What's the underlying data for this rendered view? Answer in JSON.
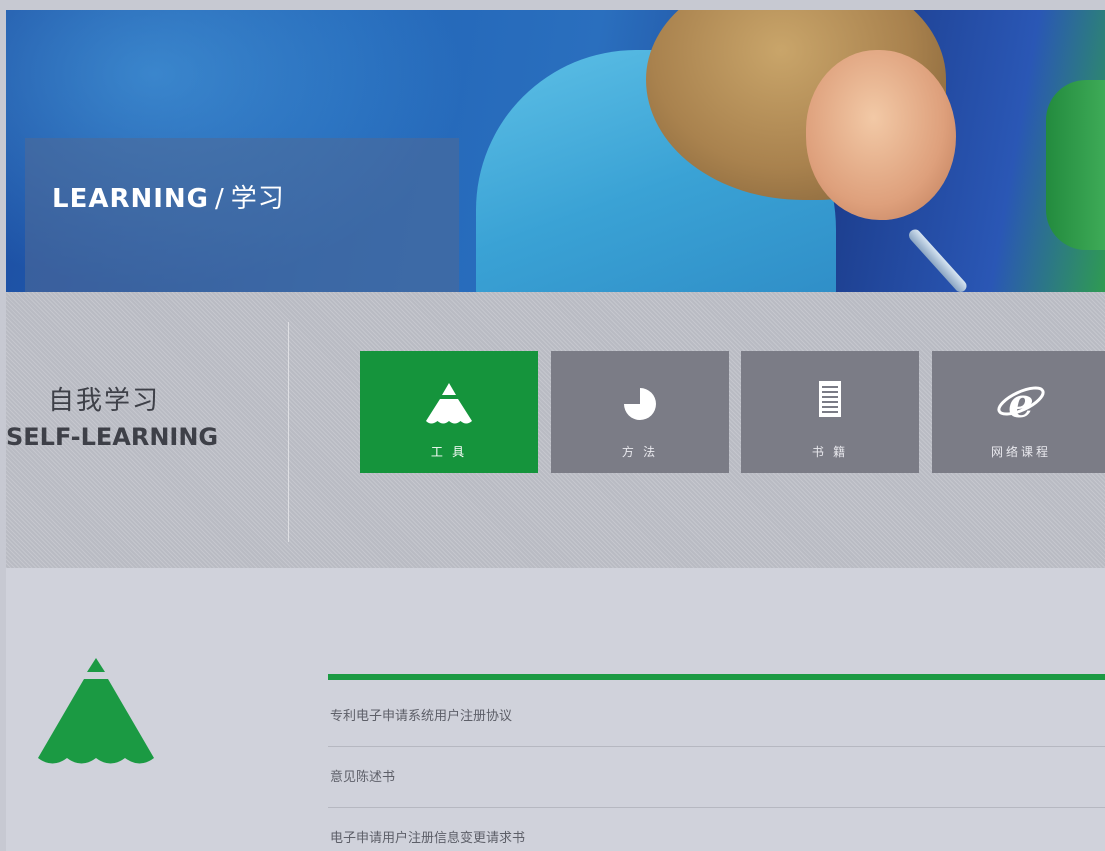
{
  "hero": {
    "title_en": "LEARNING",
    "separator": "/",
    "title_cn": "学习"
  },
  "self_learning": {
    "title_cn": "自我学习",
    "title_en": "SELF-LEARNING",
    "tiles": [
      {
        "label": "工 具",
        "icon": "pencil-icon",
        "active": true
      },
      {
        "label": "方 法",
        "icon": "pie-chart-icon",
        "active": false
      },
      {
        "label": "书 籍",
        "icon": "document-icon",
        "active": false
      },
      {
        "label": "网络课程",
        "icon": "internet-explorer-icon",
        "active": false
      }
    ]
  },
  "content": {
    "section_icon": "pencil-icon",
    "documents": [
      "专利电子申请系统用户注册协议",
      "意见陈述书",
      "电子申请用户注册信息变更请求书"
    ]
  },
  "colors": {
    "accent_green": "#15943c",
    "tile_gray": "#7b7c86",
    "band_gray": "#b9bbc3",
    "content_bg": "#d0d2db"
  }
}
